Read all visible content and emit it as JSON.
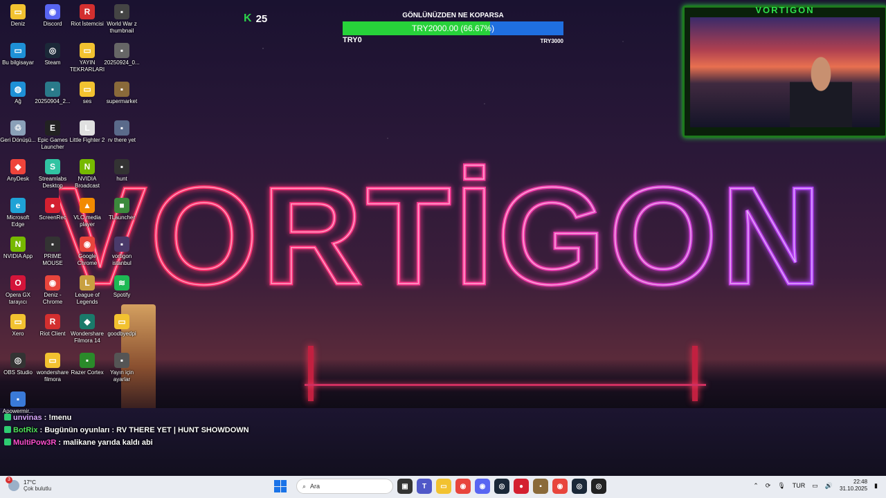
{
  "desktop_icons": [
    {
      "label": "Deniz",
      "color": "#f2c230",
      "glyph": "▭"
    },
    {
      "label": "Discord",
      "color": "#5865f2",
      "glyph": "◉"
    },
    {
      "label": "Riot İstemcisi",
      "color": "#d32f2f",
      "glyph": "R"
    },
    {
      "label": "World War z thumbnail",
      "color": "#444",
      "glyph": "▪"
    },
    {
      "label": "Bu bilgisayar",
      "color": "#1e90d6",
      "glyph": "▭"
    },
    {
      "label": "Steam",
      "color": "#1b2838",
      "glyph": "◎"
    },
    {
      "label": "YAYIN TEKRARLARI",
      "color": "#f2c230",
      "glyph": "▭"
    },
    {
      "label": "20250924_0...",
      "color": "#666",
      "glyph": "▪"
    },
    {
      "label": "Ağ",
      "color": "#1e90d6",
      "glyph": "◍"
    },
    {
      "label": "20250904_2...",
      "color": "#2a7a8a",
      "glyph": "▪"
    },
    {
      "label": "ses",
      "color": "#f2c230",
      "glyph": "▭"
    },
    {
      "label": "supermarket",
      "color": "#8a6a3a",
      "glyph": "▪"
    },
    {
      "label": "Geri Dönüşü...",
      "color": "#8aa0b8",
      "glyph": "♲"
    },
    {
      "label": "Epic Games Launcher",
      "color": "#222",
      "glyph": "E"
    },
    {
      "label": "Little Fighter 2",
      "color": "#e0e0e0",
      "glyph": "L"
    },
    {
      "label": "rv there yet",
      "color": "#5a6a8a",
      "glyph": "▪"
    },
    {
      "label": "AnyDesk",
      "color": "#ef443b",
      "glyph": "◆"
    },
    {
      "label": "Streamlabs Desktop",
      "color": "#31c3a2",
      "glyph": "S"
    },
    {
      "label": "NVIDIA Broadcast",
      "color": "#76b900",
      "glyph": "N"
    },
    {
      "label": "hunt",
      "color": "#333",
      "glyph": "▪"
    },
    {
      "label": "Microsoft Edge",
      "color": "#1fa2d6",
      "glyph": "e"
    },
    {
      "label": "ScreenRec",
      "color": "#d42030",
      "glyph": "●"
    },
    {
      "label": "VLC media player",
      "color": "#f28a00",
      "glyph": "▲"
    },
    {
      "label": "TLauncher",
      "color": "#3c8a3c",
      "glyph": "■"
    },
    {
      "label": "NVIDIA App",
      "color": "#76b900",
      "glyph": "N"
    },
    {
      "label": "PRIME MOUSE",
      "color": "#333",
      "glyph": "▪"
    },
    {
      "label": "Google Chrome",
      "color": "#e8453c",
      "glyph": "◉"
    },
    {
      "label": "vortigon istanbul",
      "color": "#4a3a6a",
      "glyph": "▪"
    },
    {
      "label": "Opera GX tarayıcı",
      "color": "#d3153a",
      "glyph": "O"
    },
    {
      "label": "Deniz - Chrome",
      "color": "#e8453c",
      "glyph": "◉"
    },
    {
      "label": "League of Legends",
      "color": "#c8a040",
      "glyph": "L"
    },
    {
      "label": "Spotify",
      "color": "#1db954",
      "glyph": "≋"
    },
    {
      "label": "Xero",
      "color": "#f2c230",
      "glyph": "▭"
    },
    {
      "label": "Riot Client",
      "color": "#d32f2f",
      "glyph": "R"
    },
    {
      "label": "Wondershare Filmora 14",
      "color": "#1a7a6a",
      "glyph": "◆"
    },
    {
      "label": "goodbyedpi",
      "color": "#f2c230",
      "glyph": "▭"
    },
    {
      "label": "OBS Studio",
      "color": "#333",
      "glyph": "◎"
    },
    {
      "label": "wondershare filmora",
      "color": "#f2c230",
      "glyph": "▭"
    },
    {
      "label": "Razer Cortex",
      "color": "#2a8a2a",
      "glyph": "▪"
    },
    {
      "label": "Yayın için ayarlar",
      "color": "#555",
      "glyph": "▪"
    },
    {
      "label": "Apowermir...",
      "color": "#3a7ad8",
      "glyph": "▪"
    }
  ],
  "kick": {
    "icon": "kick-icon",
    "count": "25"
  },
  "goal": {
    "title": "GÖNLÜNÜZDEN NE KOPARSA",
    "bar_text": "TRY2000.00 (66.67%)",
    "progress": 0.6667,
    "start": "TRY0",
    "end": "TRY3000"
  },
  "webcam": {
    "brand": "VORTIGON"
  },
  "logo_text": "VORTİGON",
  "chat": [
    {
      "user": "unvinas",
      "message": " : !menu",
      "cls": "u1"
    },
    {
      "user": "BotRix",
      "message": " : Bugünün oyunları : RV THERE YET | HUNT SHOWDOWN",
      "cls": "u2"
    },
    {
      "user": "MultiPow3R",
      "message": " : malikane yarıda kaldı abi",
      "cls": "u3"
    }
  ],
  "taskbar": {
    "weather_temp": "17°C",
    "weather_desc": "Çok bulutlu",
    "search_placeholder": "Ara",
    "language": "TUR",
    "time": "22:48",
    "date": "31.10.2025"
  },
  "colors": {
    "accent_green": "#2ecc40",
    "goal_blue": "#1f6fe0",
    "neon_red": "#ff2a55",
    "neon_purple": "#b040ff"
  }
}
